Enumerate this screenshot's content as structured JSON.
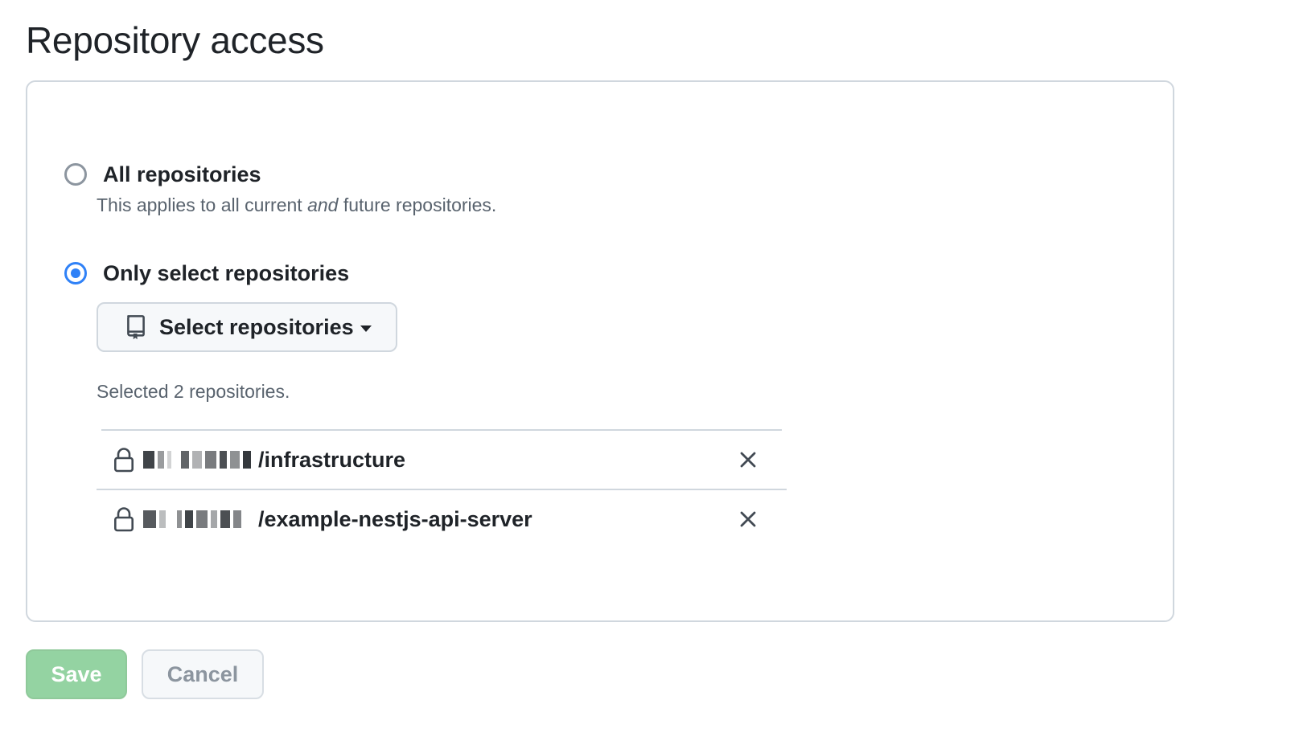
{
  "page": {
    "title": "Repository access"
  },
  "options": {
    "all": {
      "label": "All repositories",
      "selected": false,
      "description_before": "This applies to all current ",
      "description_em": "and",
      "description_after": " future repositories."
    },
    "select": {
      "label": "Only select repositories",
      "selected": true
    }
  },
  "select_button": {
    "label": "Select repositories",
    "icon": "repo-icon"
  },
  "selected_count_text": "Selected 2 repositories.",
  "repos": [
    {
      "name": "/infrastructure",
      "private": true,
      "owner_redacted": true
    },
    {
      "name": "/example-nestjs-api-server",
      "private": true,
      "owner_redacted": true
    }
  ],
  "actions": {
    "save_label": "Save",
    "cancel_label": "Cancel"
  },
  "colors": {
    "accent_blue": "#2f81f7",
    "save_green_disabled": "#94d3a2",
    "border": "#d0d7de",
    "text": "#1f2328",
    "muted": "#59636e"
  }
}
